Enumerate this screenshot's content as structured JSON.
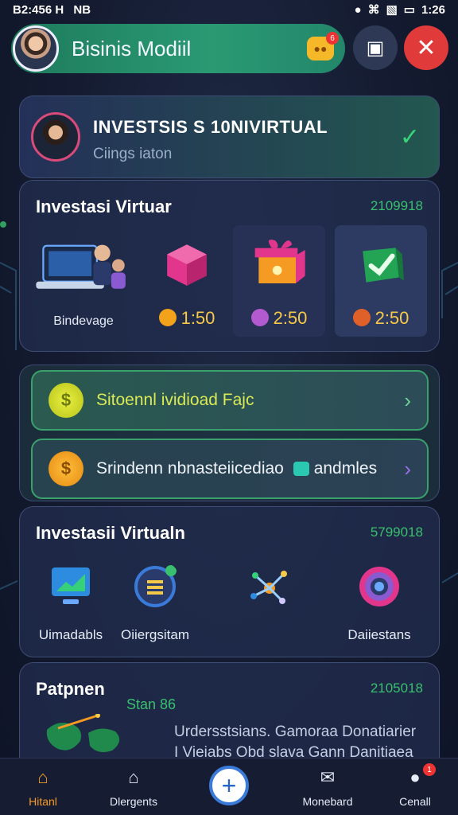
{
  "status_bar": {
    "time": "B2:456 H",
    "extra": "NB",
    "right_time": "1:26"
  },
  "header": {
    "title": "Bisinis Modiil",
    "chat_badge_count": "6"
  },
  "profile": {
    "title": "INVESTSIS S 10NIVIRTUAL",
    "subtitle": "Ciings iaton"
  },
  "virtual1": {
    "title": "Investasi Virtuar",
    "number": "2109918",
    "tiles": [
      {
        "caption": "Bindevage"
      },
      {
        "price": "1:50",
        "coin_color": "#f2a21b"
      },
      {
        "price": "2:50",
        "coin_color": "#b45ad0"
      },
      {
        "price": "2:50",
        "coin_color": "#e0602a"
      }
    ]
  },
  "rows": [
    {
      "label": "Sitoennl ividioad Fajc"
    },
    {
      "label": "Srindenn nbnasteiicediao",
      "suffix": "andmles"
    }
  ],
  "virtual2": {
    "title": "Investasii Virtualn",
    "number": "5799018",
    "features": [
      {
        "label": "Uimadabls"
      },
      {
        "label": "Oiiergsitam"
      },
      {
        "label": ""
      },
      {
        "label": "Daiiestans"
      }
    ]
  },
  "partner": {
    "title": "Patpnen",
    "number": "2105018",
    "star_text": "Stan 86",
    "desc1": "Urdersstsians. Gamoraa Donatiarier",
    "desc2": "I Vieiabs Obd slava Gann Danitiaea"
  },
  "nav": {
    "home": "Hitanl",
    "agents": "Dlergents",
    "members": "Monebard",
    "contact": "Cenall",
    "contact_badge": "1"
  },
  "colors": {
    "accent_green": "#2a9a73",
    "gold": "#f7c948",
    "danger": "#e03a3a"
  }
}
